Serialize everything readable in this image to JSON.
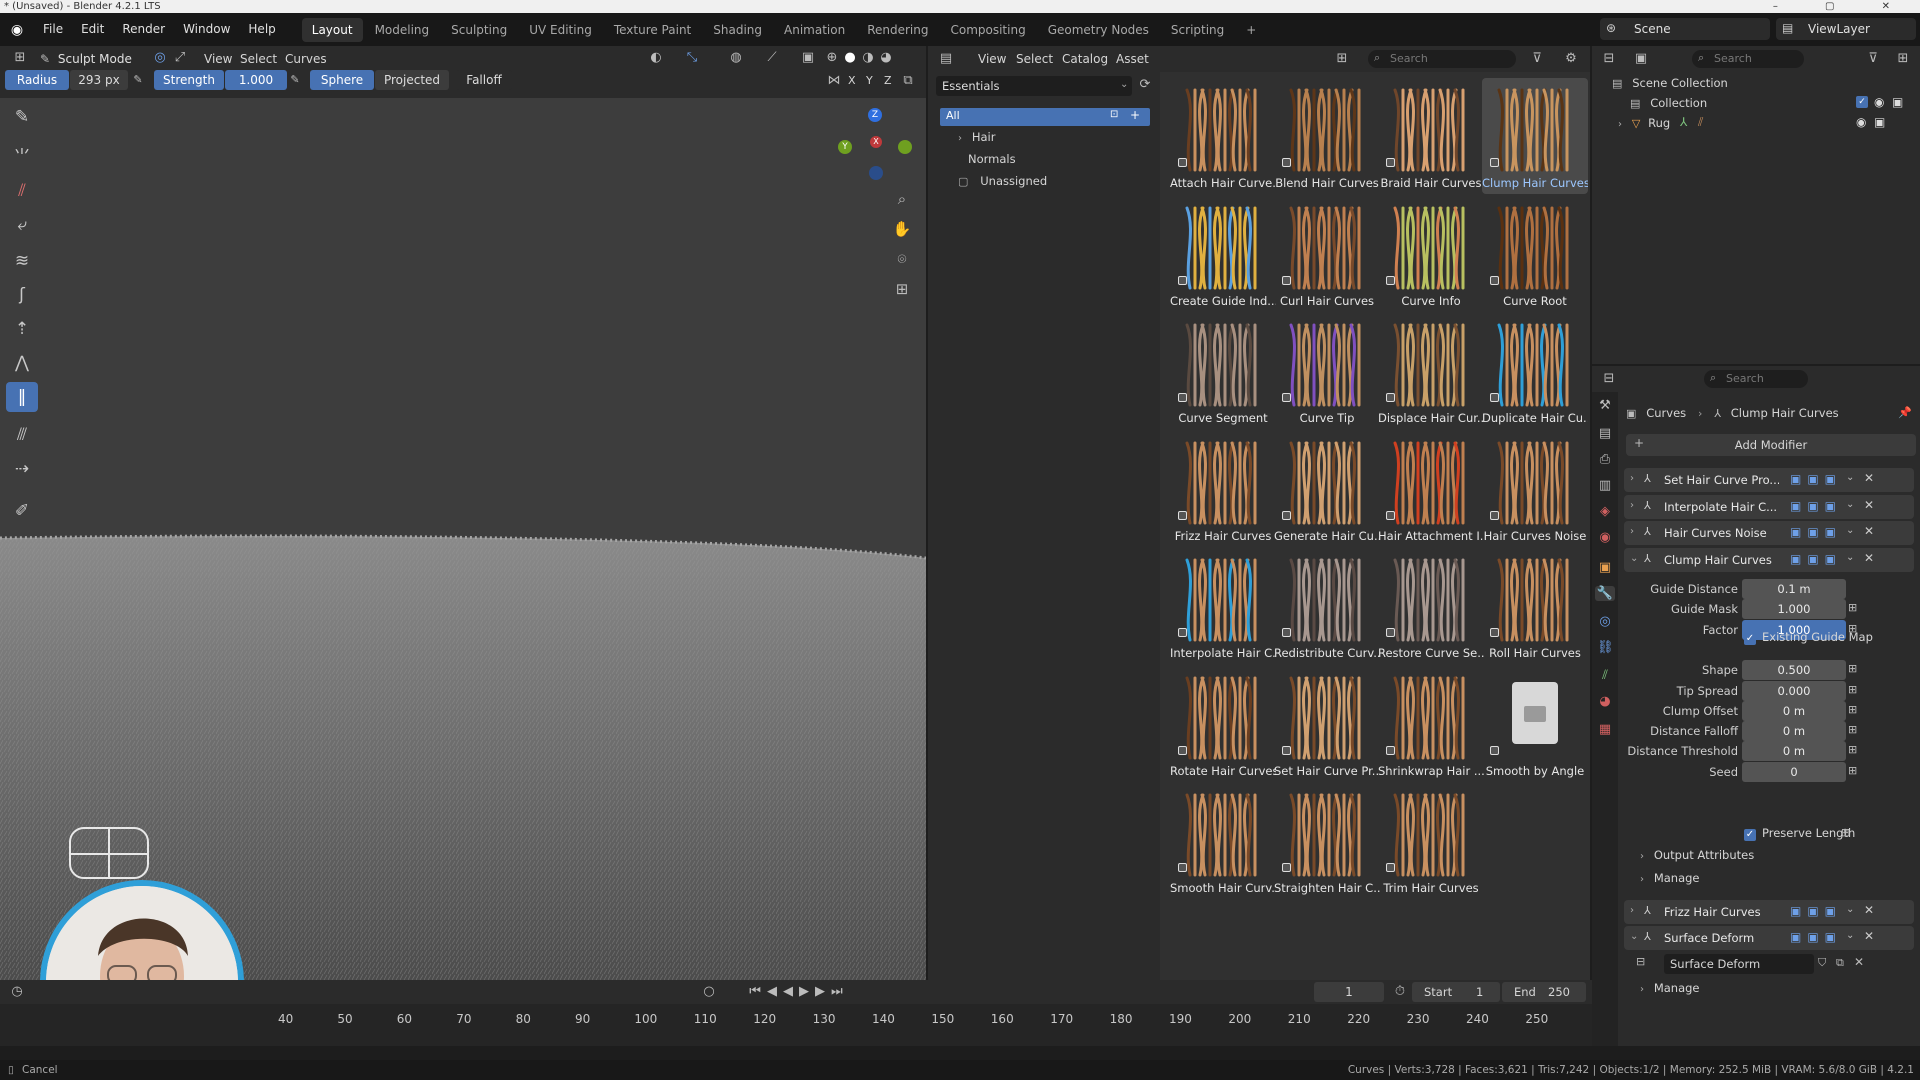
{
  "title_bar": {
    "text": "* (Unsaved) - Blender 4.2.1 LTS",
    "window_controls": "–  ▢  ✕"
  },
  "menu": {
    "items": [
      "File",
      "Edit",
      "Render",
      "Window",
      "Help"
    ]
  },
  "workspaces": [
    "Layout",
    "Modeling",
    "Sculpting",
    "UV Editing",
    "Texture Paint",
    "Shading",
    "Animation",
    "Rendering",
    "Compositing",
    "Geometry Nodes",
    "Scripting"
  ],
  "workspace_add": "+",
  "scene": {
    "label": "Scene",
    "view_layer": "ViewLayer"
  },
  "viewport_header": {
    "mode": "Sculpt Mode",
    "menus": [
      "View",
      "Select",
      "Curves"
    ],
    "radius_label": "Radius",
    "radius_value": "293 px",
    "strength_label": "Strength",
    "strength_value": "1.000",
    "sphere": "Sphere",
    "projected": "Projected",
    "falloff": "Falloff",
    "axes": [
      "X",
      "Y",
      "Z"
    ]
  },
  "gizmo": {
    "x": "X",
    "y": "Y",
    "z": "Z"
  },
  "asset_browser": {
    "menus": [
      "View",
      "Select",
      "Catalog",
      "Asset"
    ],
    "search_placeholder": "Search",
    "library": "Essentials",
    "catalog": {
      "all": "All",
      "hair": "Hair",
      "normals": "Normals",
      "unassigned": "Unassigned"
    },
    "assets": [
      "Attach Hair Curve...",
      "Blend Hair Curves",
      "Braid Hair Curves",
      "Clump Hair Curves",
      "Create Guide Ind...",
      "Curl Hair Curves",
      "Curve Info",
      "Curve Root",
      "Curve Segment",
      "Curve Tip",
      "Displace Hair Cur...",
      "Duplicate Hair Cu...",
      "Frizz Hair Curves",
      "Generate Hair Cu...",
      "Hair Attachment I...",
      "Hair Curves Noise",
      "Interpolate Hair C...",
      "Redistribute Curv...",
      "Restore Curve Se...",
      "Roll Hair Curves",
      "Rotate Hair Curves",
      "Set Hair Curve Pr...",
      "Shrinkwrap Hair ...",
      "Smooth by Angle",
      "Smooth Hair Curv...",
      "Straighten Hair C...",
      "Trim Hair Curves"
    ],
    "selected_index": 3
  },
  "outliner": {
    "search_placeholder": "Search",
    "scene_collection": "Scene Collection",
    "collection": "Collection",
    "object": "Rug"
  },
  "properties": {
    "search_placeholder": "Search",
    "breadcrumb": [
      "Curves",
      "Clump Hair Curves"
    ],
    "add_modifier": "Add Modifier",
    "modifiers": [
      "Set Hair Curve Pro...",
      "Interpolate Hair C...",
      "Hair Curves Noise",
      "Clump Hair Curves"
    ],
    "clump_fields": [
      {
        "label": "Guide Distance",
        "value": "0.1 m"
      },
      {
        "label": "Guide Mask",
        "value": "1.000"
      },
      {
        "label": "Factor",
        "value": "1.000"
      },
      {
        "label": "Shape",
        "value": "0.500"
      },
      {
        "label": "Tip Spread",
        "value": "0.000"
      },
      {
        "label": "Clump Offset",
        "value": "0 m"
      },
      {
        "label": "Distance Falloff",
        "value": "0 m"
      },
      {
        "label": "Distance Threshold",
        "value": "0 m"
      },
      {
        "label": "Seed",
        "value": "0"
      }
    ],
    "existing_guide_map": "Existing Guide Map",
    "preserve_length": "Preserve Length",
    "output_attributes": "Output Attributes",
    "manage": "Manage",
    "frizz": "Frizz Hair Curves",
    "surface_deform": "Surface Deform",
    "surface_deform_field": "Surface Deform",
    "manage2": "Manage"
  },
  "timeline": {
    "current_frame": "1",
    "start_label": "Start",
    "start": "1",
    "end_label": "End",
    "end": "250",
    "ticks": [
      "40",
      "50",
      "60",
      "70",
      "80",
      "90",
      "100",
      "110",
      "120",
      "130",
      "140",
      "150",
      "160",
      "170",
      "180",
      "190",
      "200",
      "210",
      "220",
      "230",
      "240",
      "250"
    ]
  },
  "status": {
    "cancel": "Cancel",
    "stats": "Curves | Verts:3,728 | Faces:3,621 | Tris:7,242 | Objects:1/2 | Memory: 252.5 MiB | VRAM: 5.6/8.0 GiB | 4.2.1"
  },
  "colors": {
    "accent": "#4772b3",
    "selected_text": "#9cc7ff",
    "hair": "#a8724a",
    "webcam_ring": "#2f9fd8"
  }
}
